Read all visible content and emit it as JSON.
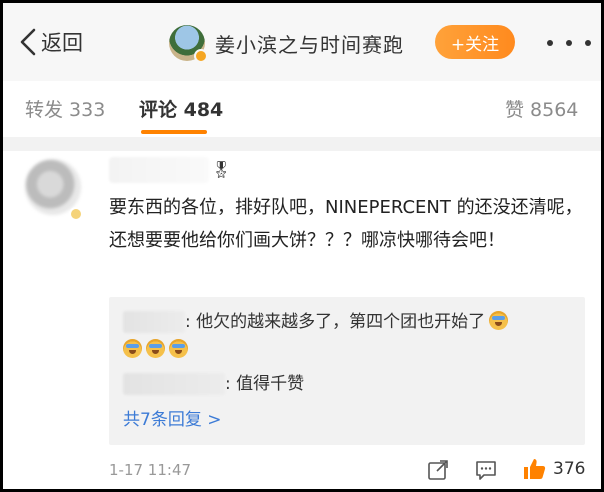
{
  "header": {
    "back_label": "返回",
    "title": "姜小滨之与时间赛跑",
    "follow_label": "+关注"
  },
  "tabs": [
    {
      "label": "转发 333"
    },
    {
      "label": "评论 484"
    },
    {
      "label": "赞 8564"
    }
  ],
  "comment": {
    "text": "要东西的各位，排好队吧，NINEPERCENT 的还没还清呢，还想要要他给你们画大饼？？？哪凉快哪待会吧！",
    "replies": [
      {
        "text": ": 他欠的越来越多了，第四个团也开始了"
      },
      {
        "text": ": 值得千赞"
      }
    ],
    "more_replies": "共7条回复 >",
    "time": "1-17 11:47",
    "like_count": "376"
  },
  "colors": {
    "accent": "#ff8200",
    "link": "#3c7bd6"
  }
}
